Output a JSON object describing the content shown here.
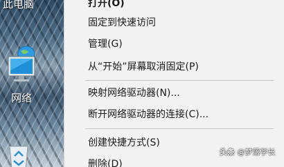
{
  "desktop": {
    "this_pc_label": "此电脑",
    "network_label": "网络",
    "icons": [
      "network-icon",
      "recycle-bin-icon"
    ]
  },
  "context_menu": {
    "items": [
      {
        "label": "打开(O)"
      },
      {
        "label": "固定到快速访问"
      },
      {
        "label": "管理(G)"
      },
      {
        "label": "从“开始”屏幕取消固定(P)"
      },
      {
        "label": "映射网络驱动器(N)..."
      },
      {
        "label": "断开网络驱动器的连接(C)..."
      },
      {
        "label": "创建快捷方式(S)"
      },
      {
        "label": "删除(D)"
      }
    ]
  },
  "watermark": {
    "platform": "头条",
    "account": "@梦落学长"
  },
  "colors": {
    "menu_background": "#f2f2f2",
    "separator": "#c8c8c8",
    "text": "#1a1a1a"
  }
}
